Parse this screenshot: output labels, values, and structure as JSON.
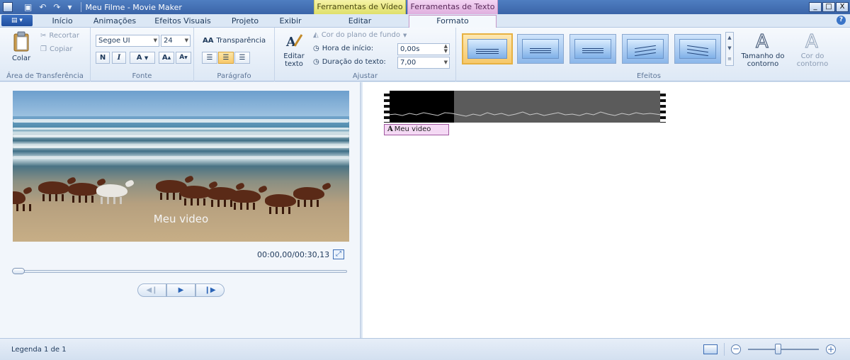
{
  "window": {
    "title": "Meu Filme - Movie Maker",
    "context_video": "Ferramentas de Vídeo",
    "context_text": "Ferramentas de Texto",
    "controls": [
      "_",
      "□",
      "X"
    ]
  },
  "tabs": [
    {
      "label": "Início"
    },
    {
      "label": "Animações"
    },
    {
      "label": "Efeitos Visuais"
    },
    {
      "label": "Projeto"
    },
    {
      "label": "Exibir"
    },
    {
      "label": "Editar"
    },
    {
      "label": "Formato",
      "active": true
    }
  ],
  "ribbon": {
    "clipboard": {
      "label": "Área de Transferência",
      "paste": "Colar",
      "cut": "Recortar",
      "copy": "Copiar"
    },
    "font": {
      "label": "Fonte",
      "family": "Segoe UI",
      "size": "24",
      "bold": "N",
      "italic": "I",
      "color": "A",
      "grow": "A",
      "shrink": "A"
    },
    "paragraph": {
      "label": "Parágrafo",
      "transparency": "Transparência"
    },
    "adjust": {
      "label": "Ajustar",
      "edit_text": "Editar texto",
      "bg_color": "Cor do plano de fundo",
      "start_time_label": "Hora de início:",
      "start_time": "0,00s",
      "duration_label": "Duração do texto:",
      "duration": "7,00"
    },
    "effects": {
      "label": "Efeitos",
      "outline_size": "Tamanho do contorno",
      "outline_color": "Cor do contorno"
    }
  },
  "preview": {
    "caption": "Meu video",
    "timecode": "00:00,00/00:30,13",
    "progress": 0.0
  },
  "storyboard": {
    "title_clip": "Meu video"
  },
  "status": {
    "text": "Legenda 1 de 1",
    "zoom_fraction": 0.4
  }
}
